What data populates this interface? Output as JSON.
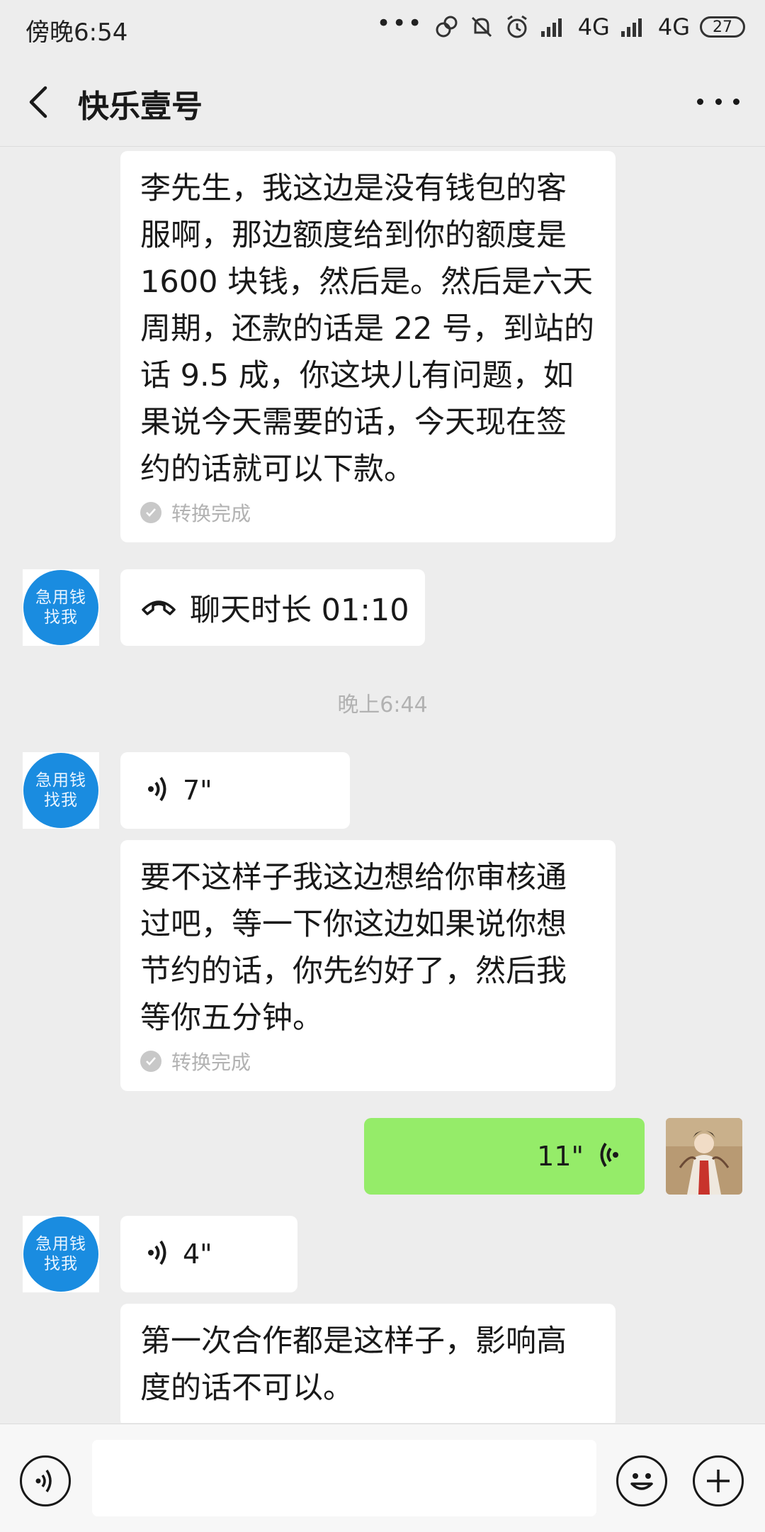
{
  "status_bar": {
    "time": "傍晚6:54",
    "network_1": "4G",
    "network_2": "4G",
    "battery": "27"
  },
  "nav": {
    "title": "快乐壹号"
  },
  "contact_avatar_text": [
    "急用钱",
    "找我"
  ],
  "messages": [
    {
      "type": "voice_text",
      "text": "李先生，我这边是没有钱包的客服啊，那边额度给到你的额度是1600 块钱，然后是。然后是六天周期，还款的话是 22 号，到站的话 9.5 成，你这块儿有问题，如果说今天需要的话，今天现在签约的话就可以下款。",
      "status": "转换完成"
    },
    {
      "type": "call",
      "text": "聊天时长 01:10"
    },
    {
      "type": "time",
      "text": "晚上6:44"
    },
    {
      "type": "voice",
      "duration": "7\""
    },
    {
      "type": "voice_text",
      "text": "要不这样子我这边想给你审核通过吧，等一下你这边如果说你想节约的话，你先约好了，然后我等你五分钟。",
      "status": "转换完成"
    },
    {
      "type": "voice_sent",
      "duration": "11\""
    },
    {
      "type": "voice",
      "duration": "4\""
    },
    {
      "type": "voice_text",
      "text": "第一次合作都是这样子，影响高度的话不可以。"
    }
  ],
  "colors": {
    "background": "#ededed",
    "bubble_in": "#ffffff",
    "bubble_out": "#95ec69",
    "avatar_blue": "#1a8ce0"
  },
  "icons": [
    "back-arrow-icon",
    "more-icon",
    "phone-icon",
    "voice-wave-icon",
    "voice-toggle-icon",
    "emoji-icon",
    "plus-icon"
  ]
}
